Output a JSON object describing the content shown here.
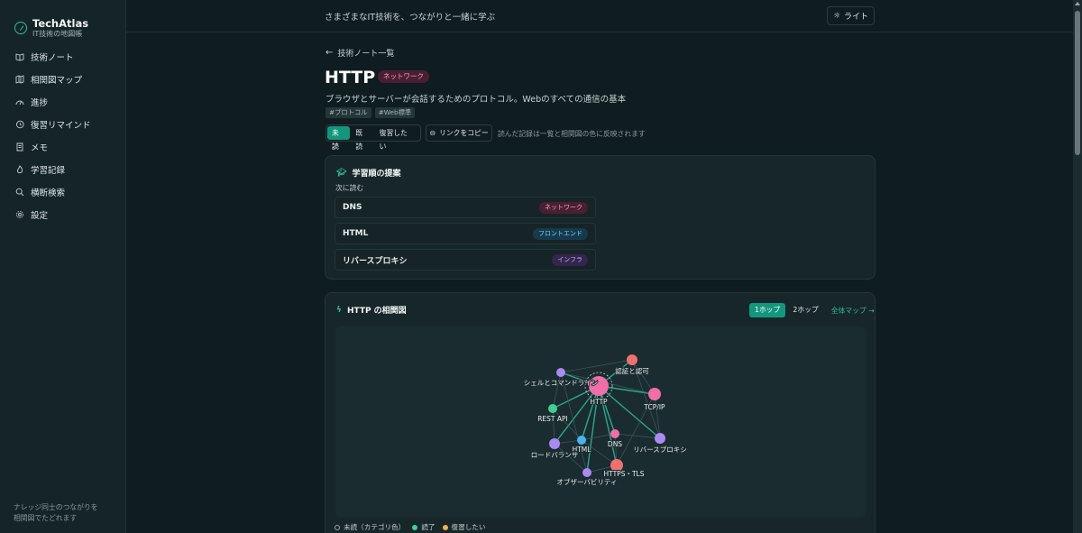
{
  "app": {
    "name": "TechAtlas",
    "subtitle": "IT技術の地図帳"
  },
  "sidebar": {
    "items": [
      {
        "label": "技術ノート",
        "icon": "book-icon"
      },
      {
        "label": "相関図マップ",
        "icon": "map-icon"
      },
      {
        "label": "進捗",
        "icon": "progress-icon"
      },
      {
        "label": "復習リマインド",
        "icon": "history-icon"
      },
      {
        "label": "メモ",
        "icon": "memo-icon"
      },
      {
        "label": "学習記録",
        "icon": "flame-icon"
      },
      {
        "label": "横断検索",
        "icon": "search-icon"
      },
      {
        "label": "設定",
        "icon": "gear-icon"
      }
    ],
    "footer_line1": "ナレッジ同士のつながりを",
    "footer_line2": "相関図でたどれます"
  },
  "header": {
    "tagline": "さまざまなIT技術を、つながりと一緒に学ぶ",
    "theme_label": "ライト"
  },
  "note": {
    "back_label": "技術ノート一覧",
    "title": "HTTP",
    "category": "ネットワーク",
    "description": "ブラウザとサーバーが会話するためのプロトコル。Webのすべての通信の基本",
    "tags": [
      "#プロトコル",
      "#Web標準"
    ],
    "status_options": [
      "未読",
      "既読",
      "復習したい"
    ],
    "status_selected": "未読",
    "copy_link_label": "リンクをコピー",
    "status_hint": "読んだ記録は一覧と相関図の色に反映されます"
  },
  "suggestions": {
    "title": "学習順の提案",
    "next_label": "次に読む",
    "items": [
      {
        "name": "DNS",
        "category": "ネットワーク",
        "badge_bg": "#4a1f33",
        "badge_fg": "#f3a3c3"
      },
      {
        "name": "HTML",
        "category": "フロントエンド",
        "badge_bg": "#163a4d",
        "badge_fg": "#7fd0f2"
      },
      {
        "name": "リバースプロキシ",
        "category": "インフラ",
        "badge_bg": "#33254d",
        "badge_fg": "#c7aef2"
      }
    ]
  },
  "graph": {
    "title": "HTTP の相関図",
    "hops": [
      "1ホップ",
      "2ホップ"
    ],
    "hop_selected": "1ホップ",
    "full_map_label": "全体マップ →",
    "nodes": [
      {
        "label": "HTTP",
        "color": "#f06fa8"
      },
      {
        "label": "認証と認可",
        "color": "#f07070"
      },
      {
        "label": "シェルとコマンドライン",
        "color": "#a98bf0"
      },
      {
        "label": "TCP/IP",
        "color": "#f06fa8"
      },
      {
        "label": "REST API",
        "color": "#3fcf95"
      },
      {
        "label": "DNS",
        "color": "#f06fa8"
      },
      {
        "label": "HTML",
        "color": "#4ab3f0"
      },
      {
        "label": "ロードバランサ",
        "color": "#a98bf0"
      },
      {
        "label": "リバースプロキシ",
        "color": "#a98bf0"
      },
      {
        "label": "HTTPS・TLS",
        "color": "#f07070"
      },
      {
        "label": "オブザーバビリティ",
        "color": "#a98bf0"
      }
    ],
    "legend": [
      {
        "label": "未読（カテゴリ色）",
        "color": "#9aa6a8"
      },
      {
        "label": "読了",
        "color": "#3fcf95"
      },
      {
        "label": "復習したい",
        "color": "#f0b34a"
      }
    ]
  }
}
